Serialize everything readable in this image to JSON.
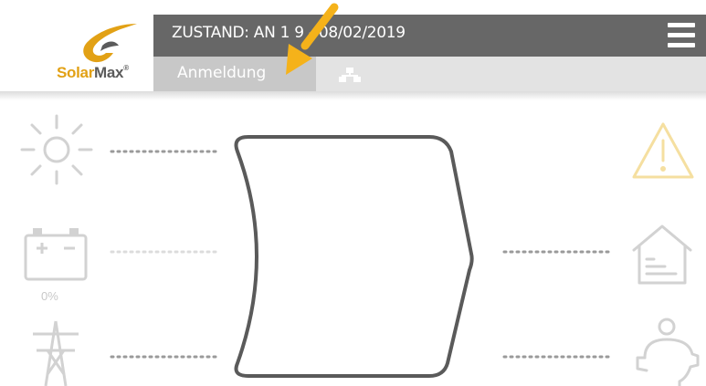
{
  "brand": {
    "name_part1": "Solar",
    "name_part2": "Max",
    "name_suffix": "®",
    "primary_color": "#e2a115",
    "secondary_color": "#5b5b5b"
  },
  "status_bar": {
    "text": "ZUSTAND: AN 1   9 - 08/02/2019",
    "background": "#676767",
    "menu_icon": "hamburger-menu-icon"
  },
  "tabs": {
    "login_label": "Anmeldung",
    "network_icon": "network-topology-icon"
  },
  "energy_flow": {
    "battery_percent": "0%",
    "left_sources": [
      "sun-icon",
      "battery-icon",
      "grid-pylon-icon"
    ],
    "right_targets": [
      "warning-icon",
      "house-icon",
      "piggy-bank-icon"
    ],
    "warning_color": "#f5dfa0",
    "icon_color": "#d2d2d2",
    "center_shape_color": "#5a5a5a"
  },
  "annotation": {
    "arrow_color": "#f5b21a",
    "arrow_icon": "pointer-arrow-icon"
  }
}
